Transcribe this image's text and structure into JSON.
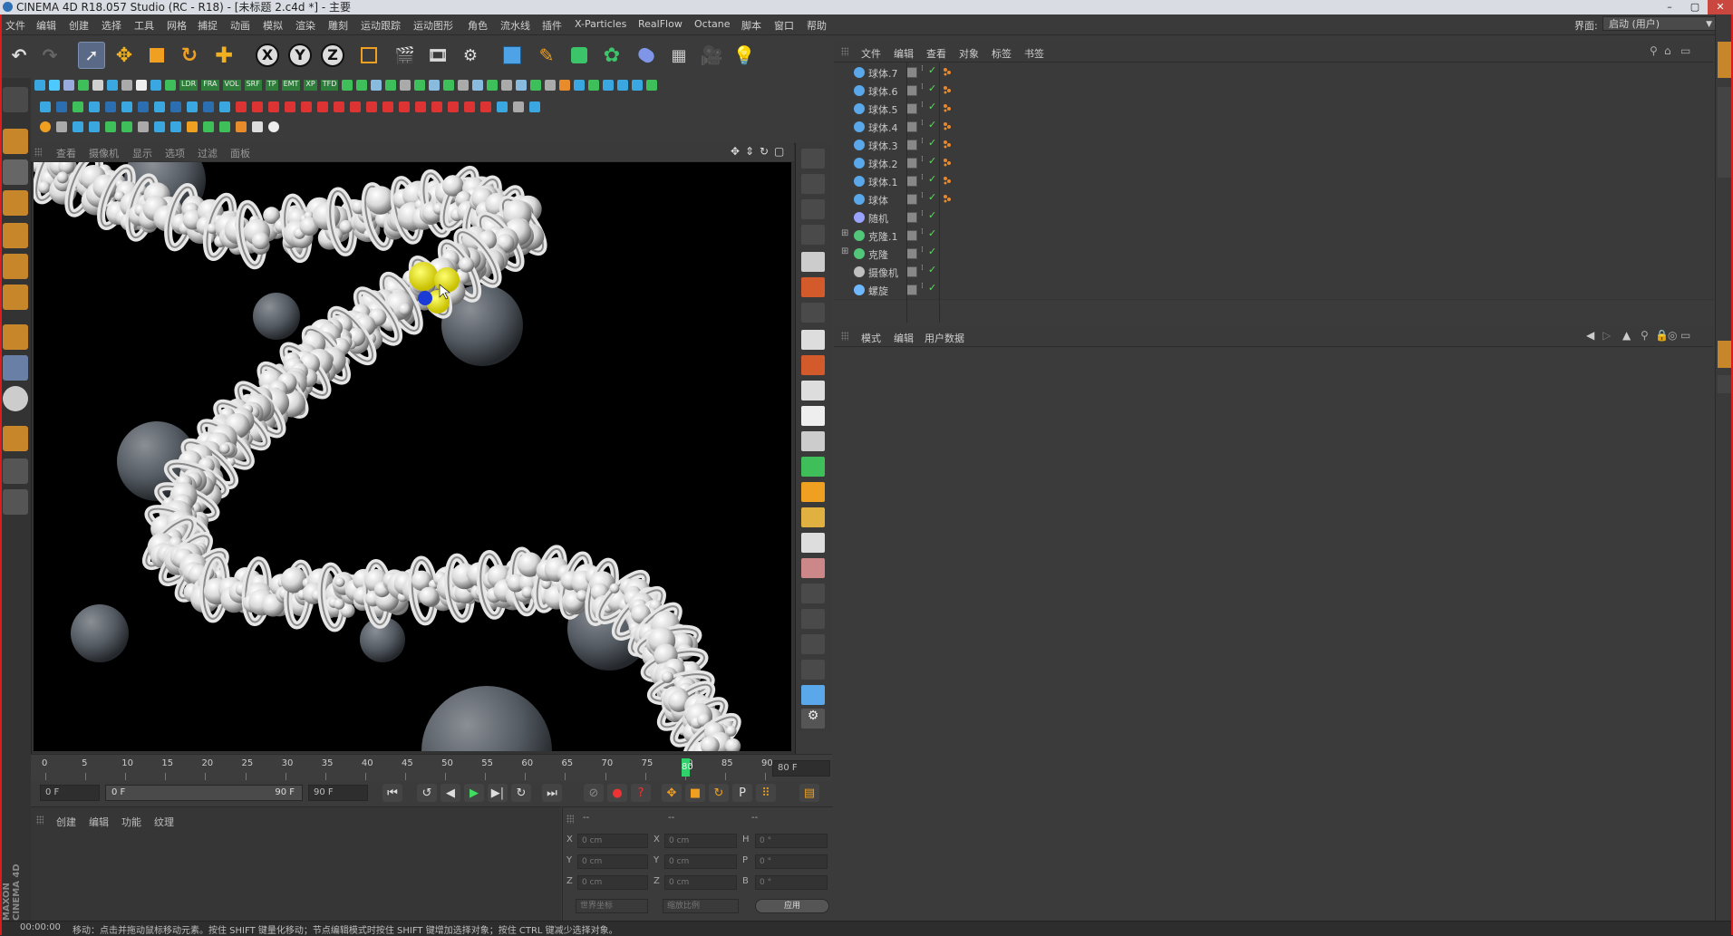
{
  "window": {
    "title": "CINEMA 4D R18.057 Studio (RC - R18) - [未标题 2.c4d *] - 主要",
    "min_label": "–",
    "max_label": "▢",
    "close_label": "✕"
  },
  "menu": {
    "items": [
      "文件",
      "编辑",
      "创建",
      "选择",
      "工具",
      "网格",
      "捕捉",
      "动画",
      "模拟",
      "渲染",
      "雕刻",
      "运动跟踪",
      "运动图形",
      "角色",
      "流水线",
      "插件",
      "X-Particles",
      "RealFlow",
      "Octane",
      "脚本",
      "窗口",
      "帮助"
    ],
    "interface_label": "界面:",
    "interface_value": "启动 (用户)"
  },
  "toolbar": {
    "axis_x": "X",
    "axis_y": "Y",
    "axis_z": "Z",
    "row2_labels": [
      "LDR",
      "FRA",
      "VOL",
      "SRF",
      "TP",
      "EMT",
      "XP",
      "TFD"
    ]
  },
  "viewport": {
    "menu": [
      "查看",
      "摄像机",
      "显示",
      "选项",
      "过滤",
      "面板"
    ]
  },
  "timeline": {
    "ticks": [
      "0",
      "5",
      "10",
      "15",
      "20",
      "25",
      "30",
      "35",
      "40",
      "45",
      "50",
      "55",
      "60",
      "65",
      "70",
      "75",
      "80",
      "85",
      "90"
    ],
    "current_frame_label": "80",
    "frame_readout": "80 F",
    "current_frame": 80,
    "range_max": 90
  },
  "transport": {
    "start_field": "0 F",
    "range_start": "0 F",
    "range_end": "90 F",
    "end_field": "90 F",
    "param_badge": "P"
  },
  "material_panel": {
    "menu": [
      "创建",
      "编辑",
      "功能",
      "纹理"
    ]
  },
  "coords": {
    "header_dashes": [
      "--",
      "--",
      "--"
    ],
    "col1_labels": [
      "X",
      "Y",
      "Z"
    ],
    "col2_labels": [
      "X",
      "Y",
      "Z"
    ],
    "col3_labels": [
      "H",
      "P",
      "B"
    ],
    "col1_values": [
      "0 cm",
      "0 cm",
      "0 cm"
    ],
    "col2_values": [
      "0 cm",
      "0 cm",
      "0 cm"
    ],
    "col3_values": [
      "0 °",
      "0 °",
      "0 °"
    ],
    "world_select": "世界坐标",
    "scale_select": "缩放比例",
    "apply_button": "应用"
  },
  "object_manager": {
    "menu": [
      "文件",
      "编辑",
      "查看",
      "对象",
      "标签",
      "书签"
    ],
    "objects": [
      {
        "name": "球体.7",
        "color": "#5aa7ea",
        "expand": ""
      },
      {
        "name": "球体.6",
        "color": "#5aa7ea",
        "expand": ""
      },
      {
        "name": "球体.5",
        "color": "#5aa7ea",
        "expand": ""
      },
      {
        "name": "球体.4",
        "color": "#5aa7ea",
        "expand": ""
      },
      {
        "name": "球体.3",
        "color": "#5aa7ea",
        "expand": ""
      },
      {
        "name": "球体.2",
        "color": "#5aa7ea",
        "expand": ""
      },
      {
        "name": "球体.1",
        "color": "#5aa7ea",
        "expand": ""
      },
      {
        "name": "球体",
        "color": "#5aa7ea",
        "expand": ""
      },
      {
        "name": "随机",
        "color": "#9aa3ff",
        "expand": ""
      },
      {
        "name": "克隆.1",
        "color": "#52c77a",
        "expand": "⊞"
      },
      {
        "name": "克隆",
        "color": "#52c77a",
        "expand": "⊞"
      },
      {
        "name": "摄像机",
        "color": "#bfbfbf",
        "expand": ""
      },
      {
        "name": "螺旋",
        "color": "#6fb8ff",
        "expand": ""
      }
    ]
  },
  "attribute_manager": {
    "menu": [
      "模式",
      "编辑",
      "用户数据"
    ]
  },
  "statusbar": {
    "time": "00:00:00",
    "message": "移动：点击并拖动鼠标移动元素。按住 SHIFT 键量化移动；节点编辑模式时按住 SHIFT 键增加选择对象；按住 CTRL 键减少选择对象。"
  },
  "branding": {
    "logo_line1": "MAXON",
    "logo_line2": "CINEMA 4D"
  },
  "colors": {
    "accent": "#5a6a86",
    "playhead": "#2fd16a",
    "check": "#5fdc5f",
    "tag": "#e8892b"
  }
}
